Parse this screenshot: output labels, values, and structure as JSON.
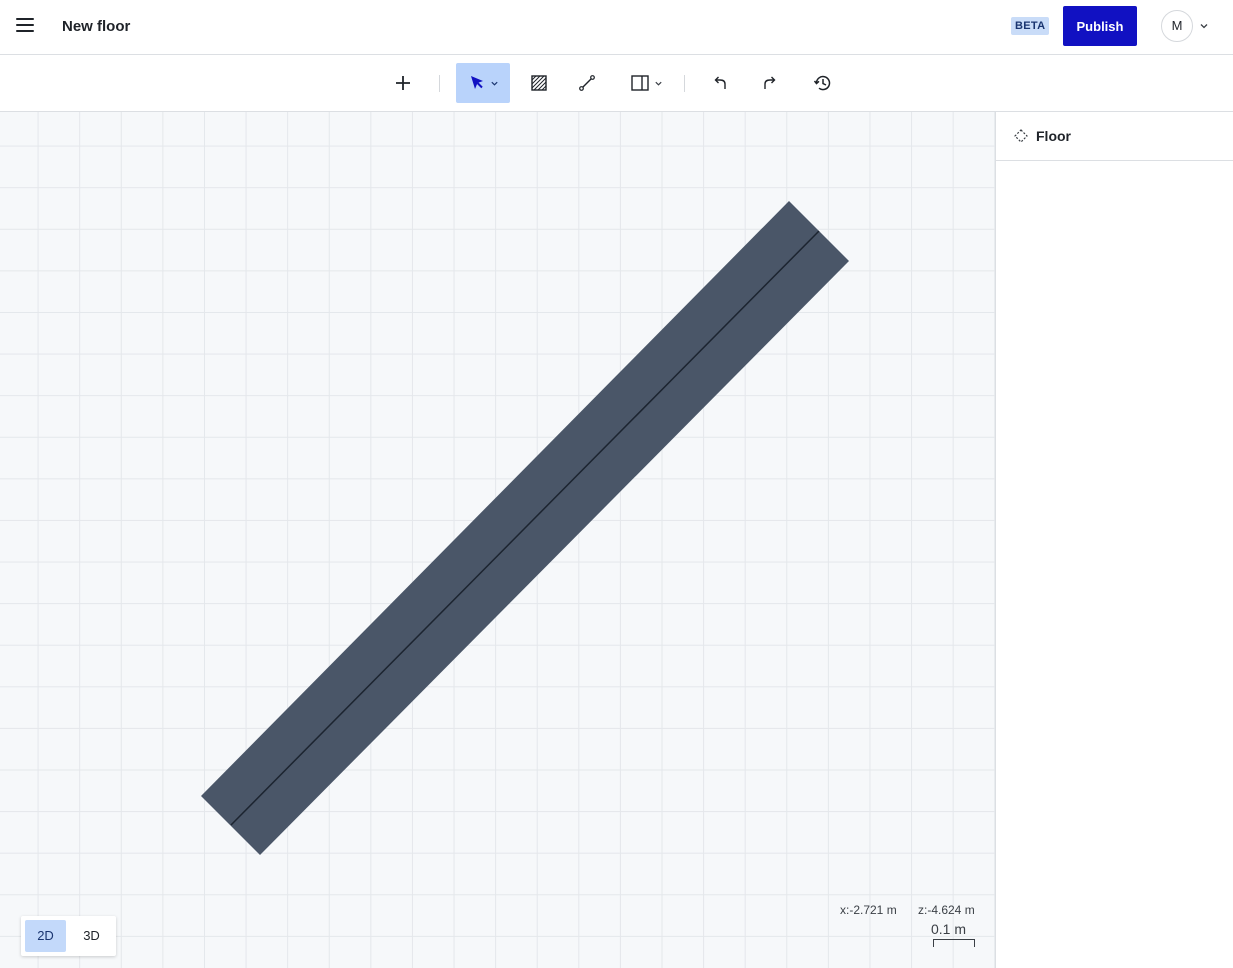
{
  "header": {
    "title": "New floor",
    "beta_label": "BETA",
    "publish_label": "Publish",
    "avatar_initial": "M"
  },
  "toolbar": {
    "tools": [
      {
        "name": "add",
        "icon": "plus-icon"
      },
      {
        "name": "select",
        "icon": "cursor-arrow-icon",
        "active": true,
        "has_menu": true
      },
      {
        "name": "area",
        "icon": "hatched-area-icon"
      },
      {
        "name": "line",
        "icon": "line-segment-icon"
      },
      {
        "name": "wall",
        "icon": "wall-panel-icon",
        "has_menu": true
      },
      {
        "name": "undo",
        "icon": "undo-icon"
      },
      {
        "name": "redo",
        "icon": "redo-icon"
      },
      {
        "name": "history",
        "icon": "history-clock-icon"
      }
    ]
  },
  "canvas": {
    "view_modes": [
      "2D",
      "3D"
    ],
    "active_view": "2D",
    "coord_x": "x:-2.721 m",
    "coord_z": "z:-4.624 m",
    "scale_label": "0.1 m",
    "wall_color": "#4a5668",
    "grid_color": "#e4e7eb",
    "background_color": "#f6f8fa"
  },
  "panel": {
    "title": "Floor",
    "icon": "floor-dashed-diamond-icon"
  },
  "colors": {
    "accent": "#1111c2",
    "active_tool_bg": "#b9d3fb",
    "beta_bg": "#c9dcf8"
  }
}
